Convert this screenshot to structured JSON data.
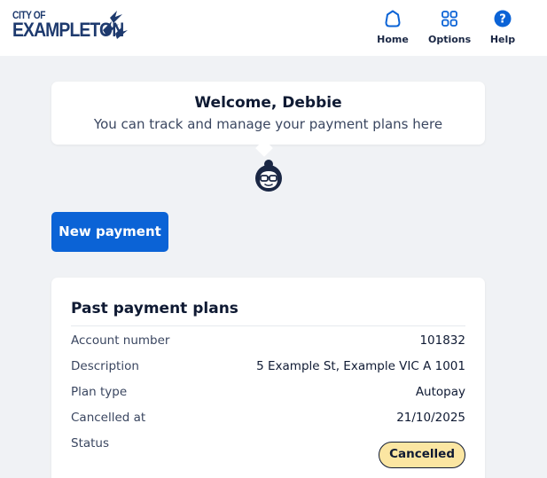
{
  "header": {
    "logo": {
      "line1": "CITY OF",
      "line2": "EXAMPLETON"
    },
    "nav": [
      {
        "label": "Home",
        "icon": "home-icon"
      },
      {
        "label": "Options",
        "icon": "grid-icon"
      },
      {
        "label": "Help",
        "icon": "help-icon"
      }
    ]
  },
  "welcome": {
    "title": "Welcome, Debbie",
    "subtitle": "You can track and manage your payment plans here"
  },
  "actions": {
    "new_payment": "New payment"
  },
  "past_plans": {
    "title": "Past payment plans",
    "rows": [
      {
        "label": "Account number",
        "value": "101832"
      },
      {
        "label": "Description",
        "value": "5 Example St, Example VIC A 1001"
      },
      {
        "label": "Plan type",
        "value": "Autopay"
      },
      {
        "label": "Cancelled at",
        "value": "21/10/2025"
      },
      {
        "label": "Status",
        "value": "Cancelled"
      }
    ]
  },
  "colors": {
    "primary": "#0b63d6",
    "logo": "#1e3a6e",
    "badge": "#fbe6a2",
    "background": "#f0f2f5"
  }
}
